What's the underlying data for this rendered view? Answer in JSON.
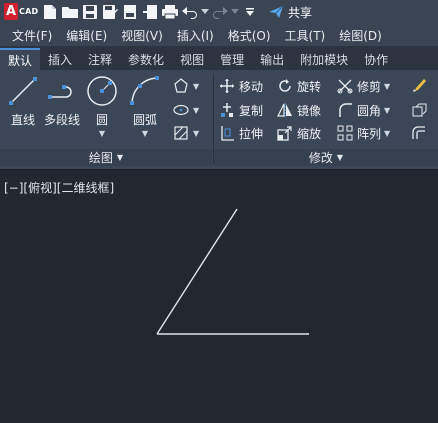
{
  "app": {
    "logo_letter": "A",
    "logo_text": "CAD"
  },
  "quick_access": {
    "icons": [
      "new-file-icon",
      "open-folder-icon",
      "save-icon",
      "save-as-icon",
      "publish-icon",
      "import-icon",
      "print-icon",
      "undo-icon",
      "redo-icon",
      "customize-dropdown-icon"
    ],
    "share_label": "共享"
  },
  "menubar": [
    "文件(F)",
    "编辑(E)",
    "视图(V)",
    "插入(I)",
    "格式(O)",
    "工具(T)",
    "绘图(D)"
  ],
  "tabs": [
    "默认",
    "插入",
    "注释",
    "参数化",
    "视图",
    "管理",
    "输出",
    "附加模块",
    "协作"
  ],
  "active_tab": "默认",
  "draw_panel": {
    "title": "绘图",
    "line": "直线",
    "polyline": "多段线",
    "circle": "圆",
    "arc": "圆弧"
  },
  "modify_panel": {
    "title": "修改",
    "move": "移动",
    "rotate": "旋转",
    "trim": "修剪",
    "copy": "复制",
    "mirror": "镜像",
    "fillet": "圆角",
    "stretch": "拉伸",
    "scale": "缩放",
    "array": "阵列"
  },
  "viewport": {
    "label": "[−][俯视][二维线框]",
    "background_color": "#212830",
    "line_color": "#e0e4ea"
  }
}
